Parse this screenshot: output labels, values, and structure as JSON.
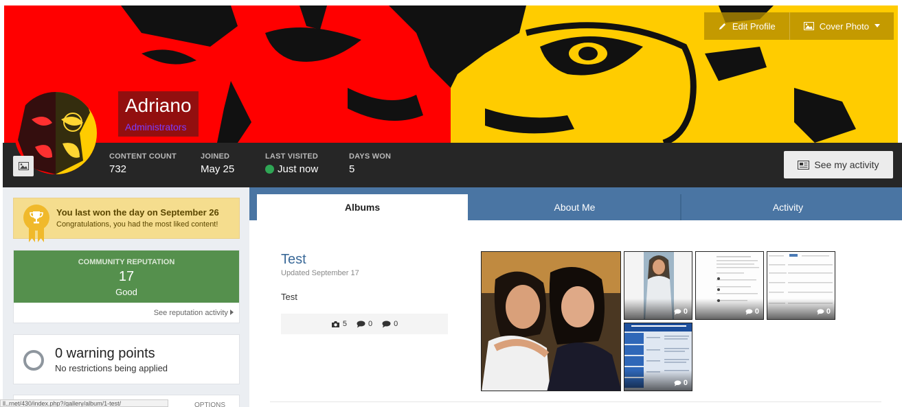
{
  "cover": {
    "colors": {
      "left": "#ff0000",
      "right": "#ffcc00"
    },
    "edit_profile_label": "Edit Profile",
    "cover_photo_label": "Cover Photo"
  },
  "profile": {
    "name": "Adriano",
    "group": "Administrators"
  },
  "stats": [
    {
      "label": "CONTENT COUNT",
      "value": "732"
    },
    {
      "label": "JOINED",
      "value": "May 25"
    },
    {
      "label": "LAST VISITED",
      "value": "Just now"
    },
    {
      "label": "DAYS WON",
      "value": "5"
    }
  ],
  "activity_button": "See my activity",
  "sidebar": {
    "won": {
      "title": "You last won the day on September 26",
      "subtitle": "Congratulations, you had the most liked content!"
    },
    "reputation": {
      "label": "COMMUNITY REPUTATION",
      "value": "17",
      "text": "Good",
      "link": "See reputation activity"
    },
    "warnings": {
      "title": "0 warning points",
      "subtitle": "No restrictions being applied"
    },
    "options_label": "OPTIONS",
    "status_url": "ll..rnet/430/index.php?/gallery/album/1-test/"
  },
  "tabs": [
    {
      "label": "Albums",
      "active": true
    },
    {
      "label": "About Me",
      "active": false
    },
    {
      "label": "Activity",
      "active": false
    }
  ],
  "album": {
    "title": "Test",
    "updated": "Updated September 17",
    "description": "Test",
    "images_count": "5",
    "comments_count": "0",
    "reviews_count": "0",
    "thumb_comments": [
      "0",
      "0",
      "0",
      "0"
    ]
  }
}
